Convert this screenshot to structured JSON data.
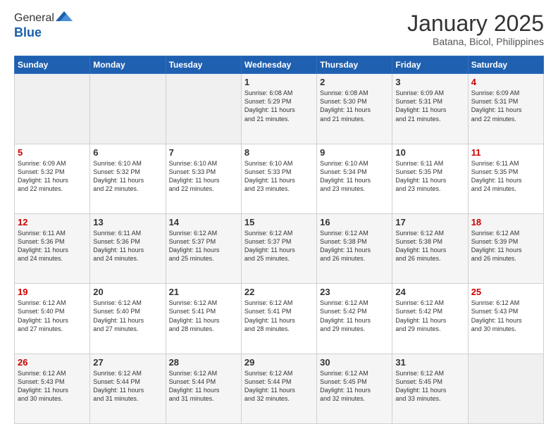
{
  "header": {
    "logo_general": "General",
    "logo_blue": "Blue",
    "main_title": "January 2025",
    "subtitle": "Batana, Bicol, Philippines"
  },
  "calendar": {
    "days_of_week": [
      "Sunday",
      "Monday",
      "Tuesday",
      "Wednesday",
      "Thursday",
      "Friday",
      "Saturday"
    ],
    "weeks": [
      [
        {
          "day": "",
          "info": ""
        },
        {
          "day": "",
          "info": ""
        },
        {
          "day": "",
          "info": ""
        },
        {
          "day": "1",
          "info": "Sunrise: 6:08 AM\nSunset: 5:29 PM\nDaylight: 11 hours\nand 21 minutes."
        },
        {
          "day": "2",
          "info": "Sunrise: 6:08 AM\nSunset: 5:30 PM\nDaylight: 11 hours\nand 21 minutes."
        },
        {
          "day": "3",
          "info": "Sunrise: 6:09 AM\nSunset: 5:31 PM\nDaylight: 11 hours\nand 21 minutes."
        },
        {
          "day": "4",
          "info": "Sunrise: 6:09 AM\nSunset: 5:31 PM\nDaylight: 11 hours\nand 22 minutes."
        }
      ],
      [
        {
          "day": "5",
          "info": "Sunrise: 6:09 AM\nSunset: 5:32 PM\nDaylight: 11 hours\nand 22 minutes."
        },
        {
          "day": "6",
          "info": "Sunrise: 6:10 AM\nSunset: 5:32 PM\nDaylight: 11 hours\nand 22 minutes."
        },
        {
          "day": "7",
          "info": "Sunrise: 6:10 AM\nSunset: 5:33 PM\nDaylight: 11 hours\nand 22 minutes."
        },
        {
          "day": "8",
          "info": "Sunrise: 6:10 AM\nSunset: 5:33 PM\nDaylight: 11 hours\nand 23 minutes."
        },
        {
          "day": "9",
          "info": "Sunrise: 6:10 AM\nSunset: 5:34 PM\nDaylight: 11 hours\nand 23 minutes."
        },
        {
          "day": "10",
          "info": "Sunrise: 6:11 AM\nSunset: 5:35 PM\nDaylight: 11 hours\nand 23 minutes."
        },
        {
          "day": "11",
          "info": "Sunrise: 6:11 AM\nSunset: 5:35 PM\nDaylight: 11 hours\nand 24 minutes."
        }
      ],
      [
        {
          "day": "12",
          "info": "Sunrise: 6:11 AM\nSunset: 5:36 PM\nDaylight: 11 hours\nand 24 minutes."
        },
        {
          "day": "13",
          "info": "Sunrise: 6:11 AM\nSunset: 5:36 PM\nDaylight: 11 hours\nand 24 minutes."
        },
        {
          "day": "14",
          "info": "Sunrise: 6:12 AM\nSunset: 5:37 PM\nDaylight: 11 hours\nand 25 minutes."
        },
        {
          "day": "15",
          "info": "Sunrise: 6:12 AM\nSunset: 5:37 PM\nDaylight: 11 hours\nand 25 minutes."
        },
        {
          "day": "16",
          "info": "Sunrise: 6:12 AM\nSunset: 5:38 PM\nDaylight: 11 hours\nand 26 minutes."
        },
        {
          "day": "17",
          "info": "Sunrise: 6:12 AM\nSunset: 5:38 PM\nDaylight: 11 hours\nand 26 minutes."
        },
        {
          "day": "18",
          "info": "Sunrise: 6:12 AM\nSunset: 5:39 PM\nDaylight: 11 hours\nand 26 minutes."
        }
      ],
      [
        {
          "day": "19",
          "info": "Sunrise: 6:12 AM\nSunset: 5:40 PM\nDaylight: 11 hours\nand 27 minutes."
        },
        {
          "day": "20",
          "info": "Sunrise: 6:12 AM\nSunset: 5:40 PM\nDaylight: 11 hours\nand 27 minutes."
        },
        {
          "day": "21",
          "info": "Sunrise: 6:12 AM\nSunset: 5:41 PM\nDaylight: 11 hours\nand 28 minutes."
        },
        {
          "day": "22",
          "info": "Sunrise: 6:12 AM\nSunset: 5:41 PM\nDaylight: 11 hours\nand 28 minutes."
        },
        {
          "day": "23",
          "info": "Sunrise: 6:12 AM\nSunset: 5:42 PM\nDaylight: 11 hours\nand 29 minutes."
        },
        {
          "day": "24",
          "info": "Sunrise: 6:12 AM\nSunset: 5:42 PM\nDaylight: 11 hours\nand 29 minutes."
        },
        {
          "day": "25",
          "info": "Sunrise: 6:12 AM\nSunset: 5:43 PM\nDaylight: 11 hours\nand 30 minutes."
        }
      ],
      [
        {
          "day": "26",
          "info": "Sunrise: 6:12 AM\nSunset: 5:43 PM\nDaylight: 11 hours\nand 30 minutes."
        },
        {
          "day": "27",
          "info": "Sunrise: 6:12 AM\nSunset: 5:44 PM\nDaylight: 11 hours\nand 31 minutes."
        },
        {
          "day": "28",
          "info": "Sunrise: 6:12 AM\nSunset: 5:44 PM\nDaylight: 11 hours\nand 31 minutes."
        },
        {
          "day": "29",
          "info": "Sunrise: 6:12 AM\nSunset: 5:44 PM\nDaylight: 11 hours\nand 32 minutes."
        },
        {
          "day": "30",
          "info": "Sunrise: 6:12 AM\nSunset: 5:45 PM\nDaylight: 11 hours\nand 32 minutes."
        },
        {
          "day": "31",
          "info": "Sunrise: 6:12 AM\nSunset: 5:45 PM\nDaylight: 11 hours\nand 33 minutes."
        },
        {
          "day": "",
          "info": ""
        }
      ]
    ]
  }
}
